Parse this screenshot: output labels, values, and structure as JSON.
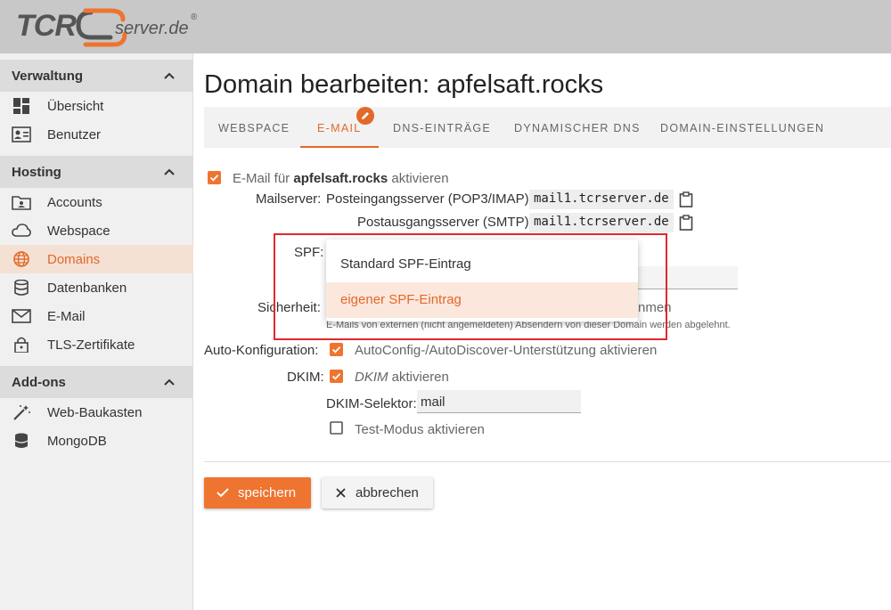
{
  "logo": {
    "brand": "TCR",
    "domain": "server.de",
    "reg": "®"
  },
  "sidebar": {
    "sections": [
      {
        "title": "Verwaltung",
        "items": [
          {
            "label": "Übersicht",
            "icon": "dashboard-icon"
          },
          {
            "label": "Benutzer",
            "icon": "user-card-icon"
          }
        ]
      },
      {
        "title": "Hosting",
        "items": [
          {
            "label": "Accounts",
            "icon": "account-folder-icon"
          },
          {
            "label": "Webspace",
            "icon": "cloud-icon"
          },
          {
            "label": "Domains",
            "icon": "globe-icon",
            "active": true
          },
          {
            "label": "Datenbanken",
            "icon": "database-icon"
          },
          {
            "label": "E-Mail",
            "icon": "envelope-icon"
          },
          {
            "label": "TLS-Zertifikate",
            "icon": "lock-icon"
          }
        ]
      },
      {
        "title": "Add-ons",
        "items": [
          {
            "label": "Web-Baukasten",
            "icon": "magic-wand-icon"
          },
          {
            "label": "MongoDB",
            "icon": "database-icon"
          }
        ]
      }
    ]
  },
  "page": {
    "title": "Domain bearbeiten: apfelsaft.rocks"
  },
  "tabs": [
    {
      "label": "WEBSPACE"
    },
    {
      "label": "E-MAIL",
      "active": true
    },
    {
      "label": "DNS-EINTRÄGE"
    },
    {
      "label": "DYNAMISCHER DNS"
    },
    {
      "label": "DOMAIN-EINSTELLUNGEN"
    }
  ],
  "email": {
    "enable_prefix": "E-Mail für",
    "enable_domain": "apfelsaft.rocks",
    "enable_suffix": "aktivieren",
    "mailserver_label": "Mailserver:",
    "incoming_label": "Posteingangsserver (POP3/IMAP):",
    "incoming_value": "mail1.tcrserver.de",
    "outgoing_label": "Postausgangsserver (SMTP):",
    "outgoing_value": "mail1.tcrserver.de",
    "spf_label": "SPF:",
    "security_label": "Sicherheit:",
    "security_tail": "nmen",
    "security_hint": "E-Mails von externen (nicht angemeldeten) Absendern von dieser Domain werden abgelehnt.",
    "spf_options": [
      {
        "label": "Standard SPF-Eintrag"
      },
      {
        "label": "eigener SPF-Eintrag",
        "selected": true
      }
    ],
    "autoconfig_label": "Auto-Konfiguration:",
    "autoconfig_text": "AutoConfig-/AutoDiscover-Unterstützung aktivieren",
    "dkim_label": "DKIM:",
    "dkim_em": "DKIM",
    "dkim_text": "aktivieren",
    "dkim_selector_label": "DKIM-Selektor:",
    "dkim_selector_value": "mail",
    "test_mode_text": "Test-Modus aktivieren"
  },
  "buttons": {
    "save": "speichern",
    "cancel": "abbrechen"
  },
  "colors": {
    "accent": "#ee7430",
    "highlight_box": "#e0282e"
  }
}
